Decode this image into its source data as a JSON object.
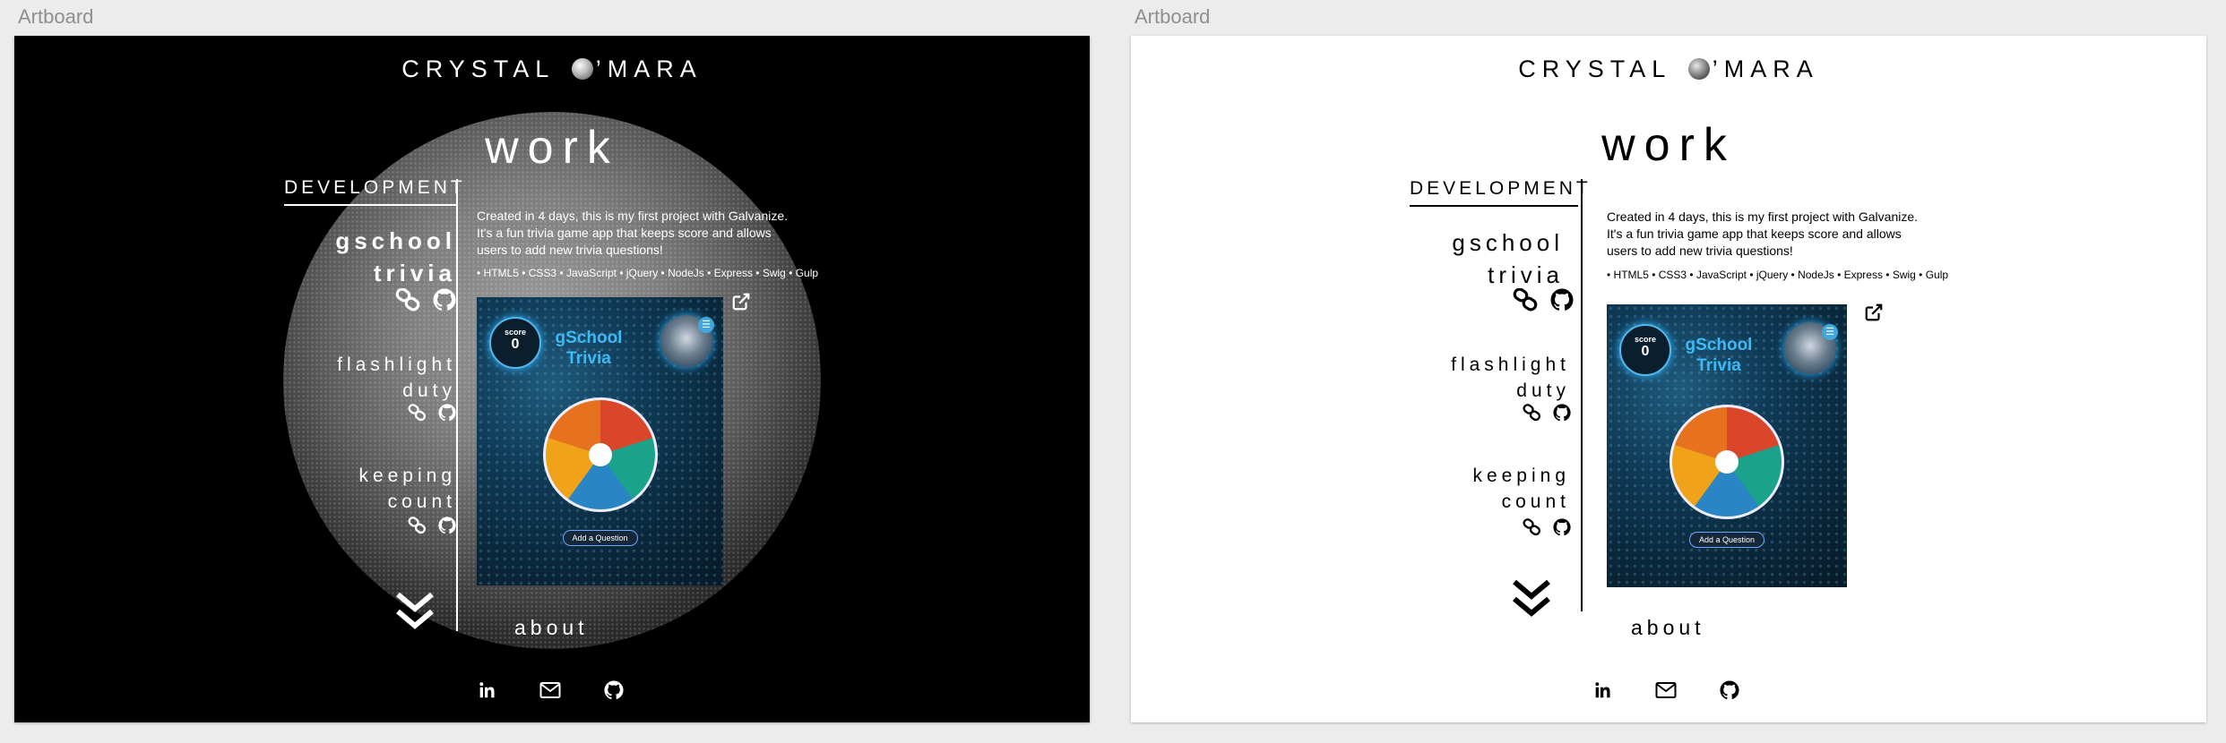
{
  "artboards": [
    {
      "label": "Artboard",
      "theme": "dark",
      "bg": "#000000",
      "fg": "#ffffff"
    },
    {
      "label": "Artboard",
      "theme": "light",
      "bg": "#ffffff",
      "fg": "#000000"
    }
  ],
  "site": {
    "logo_left": "CRYSTAL ",
    "logo_right": "’MARA",
    "heading": "work",
    "section": "DEVELOPMENT",
    "about": "about"
  },
  "projects": [
    {
      "line1": "gschool",
      "line2": "trivia",
      "icons": [
        "link-icon",
        "github-icon"
      ]
    },
    {
      "line1": "flashlight",
      "line2": "duty",
      "icons": [
        "link-icon",
        "github-icon"
      ]
    },
    {
      "line1": "keeping",
      "line2": "count",
      "icons": [
        "link-icon",
        "github-icon"
      ]
    }
  ],
  "detail": {
    "desc_lines": [
      "Created in 4 days, this is my first project with Galvanize.",
      "It's a fun trivia game app that keeps score and allows",
      "users to add new trivia questions!"
    ],
    "tech": "• HTML5 • CSS3 •  JavaScript • jQuery • NodeJs • Express • Swig • Gulp",
    "external_icon": "external-link-icon"
  },
  "preview": {
    "score_label": "score",
    "score_value": "0",
    "title_line1": "gSchool",
    "title_line2": "Trivia",
    "button": "Add a Question",
    "menu_glyph": "☰",
    "wheel_colors": [
      "#d9462a",
      "#1aa38a",
      "#2a85c5",
      "#f0a218",
      "#e67220"
    ]
  },
  "social": [
    "linkedin-icon",
    "mail-icon",
    "github-icon"
  ]
}
